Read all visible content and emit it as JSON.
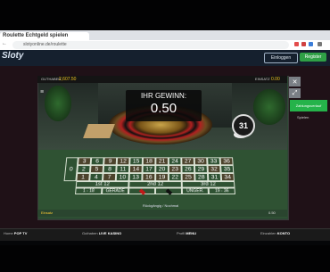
{
  "browser": {
    "tab_title": "Roulette Echtgeld spielen",
    "url": "slotyonline.de/roulette",
    "nav": {
      "back": "←",
      "forward": "→",
      "reload": "↻"
    }
  },
  "site": {
    "logo": "Sloty",
    "login_label": "Einloggen",
    "register_label": "Register"
  },
  "game": {
    "balance_label": "GUTHABEN",
    "balance_value": "2,607.50",
    "stake_label": "EINSATZ",
    "stake_value": "0.00",
    "win_label": "IHR GEWINN:",
    "win_amount": "0.50",
    "result_number": "31",
    "side_tag": "Zahlungsverlauf",
    "side_label": "Spielen",
    "table_hint": "Rückgängig / Nochmal",
    "bottom_left": "Einsatz",
    "bottom_right": "0.50",
    "table": {
      "zero": "0",
      "rows": [
        [
          "3",
          "6",
          "9",
          "12",
          "15",
          "18",
          "21",
          "24",
          "27",
          "30",
          "33",
          "36"
        ],
        [
          "2",
          "5",
          "8",
          "11",
          "14",
          "17",
          "20",
          "23",
          "26",
          "29",
          "32",
          "35"
        ],
        [
          "1",
          "4",
          "7",
          "10",
          "13",
          "16",
          "19",
          "22",
          "25",
          "28",
          "31",
          "34"
        ]
      ],
      "dozens": [
        "1st 12",
        "2nd 12",
        "3rd 12"
      ],
      "outside": [
        "1 - 18",
        "GERADE",
        "",
        "",
        "UNGER.",
        "19 - 36"
      ]
    }
  },
  "taskbar": [
    {
      "name": "Home",
      "value": "POP TV"
    },
    {
      "name": "Guthaben",
      "value": "LIVE KASINO"
    },
    {
      "name": "Profil",
      "value": "MENU"
    },
    {
      "name": "Einzahlen",
      "value": "KONTO"
    }
  ],
  "colors": {
    "accent_green": "#25b34a",
    "gold": "#f0c020",
    "felt": "#2f5233"
  }
}
